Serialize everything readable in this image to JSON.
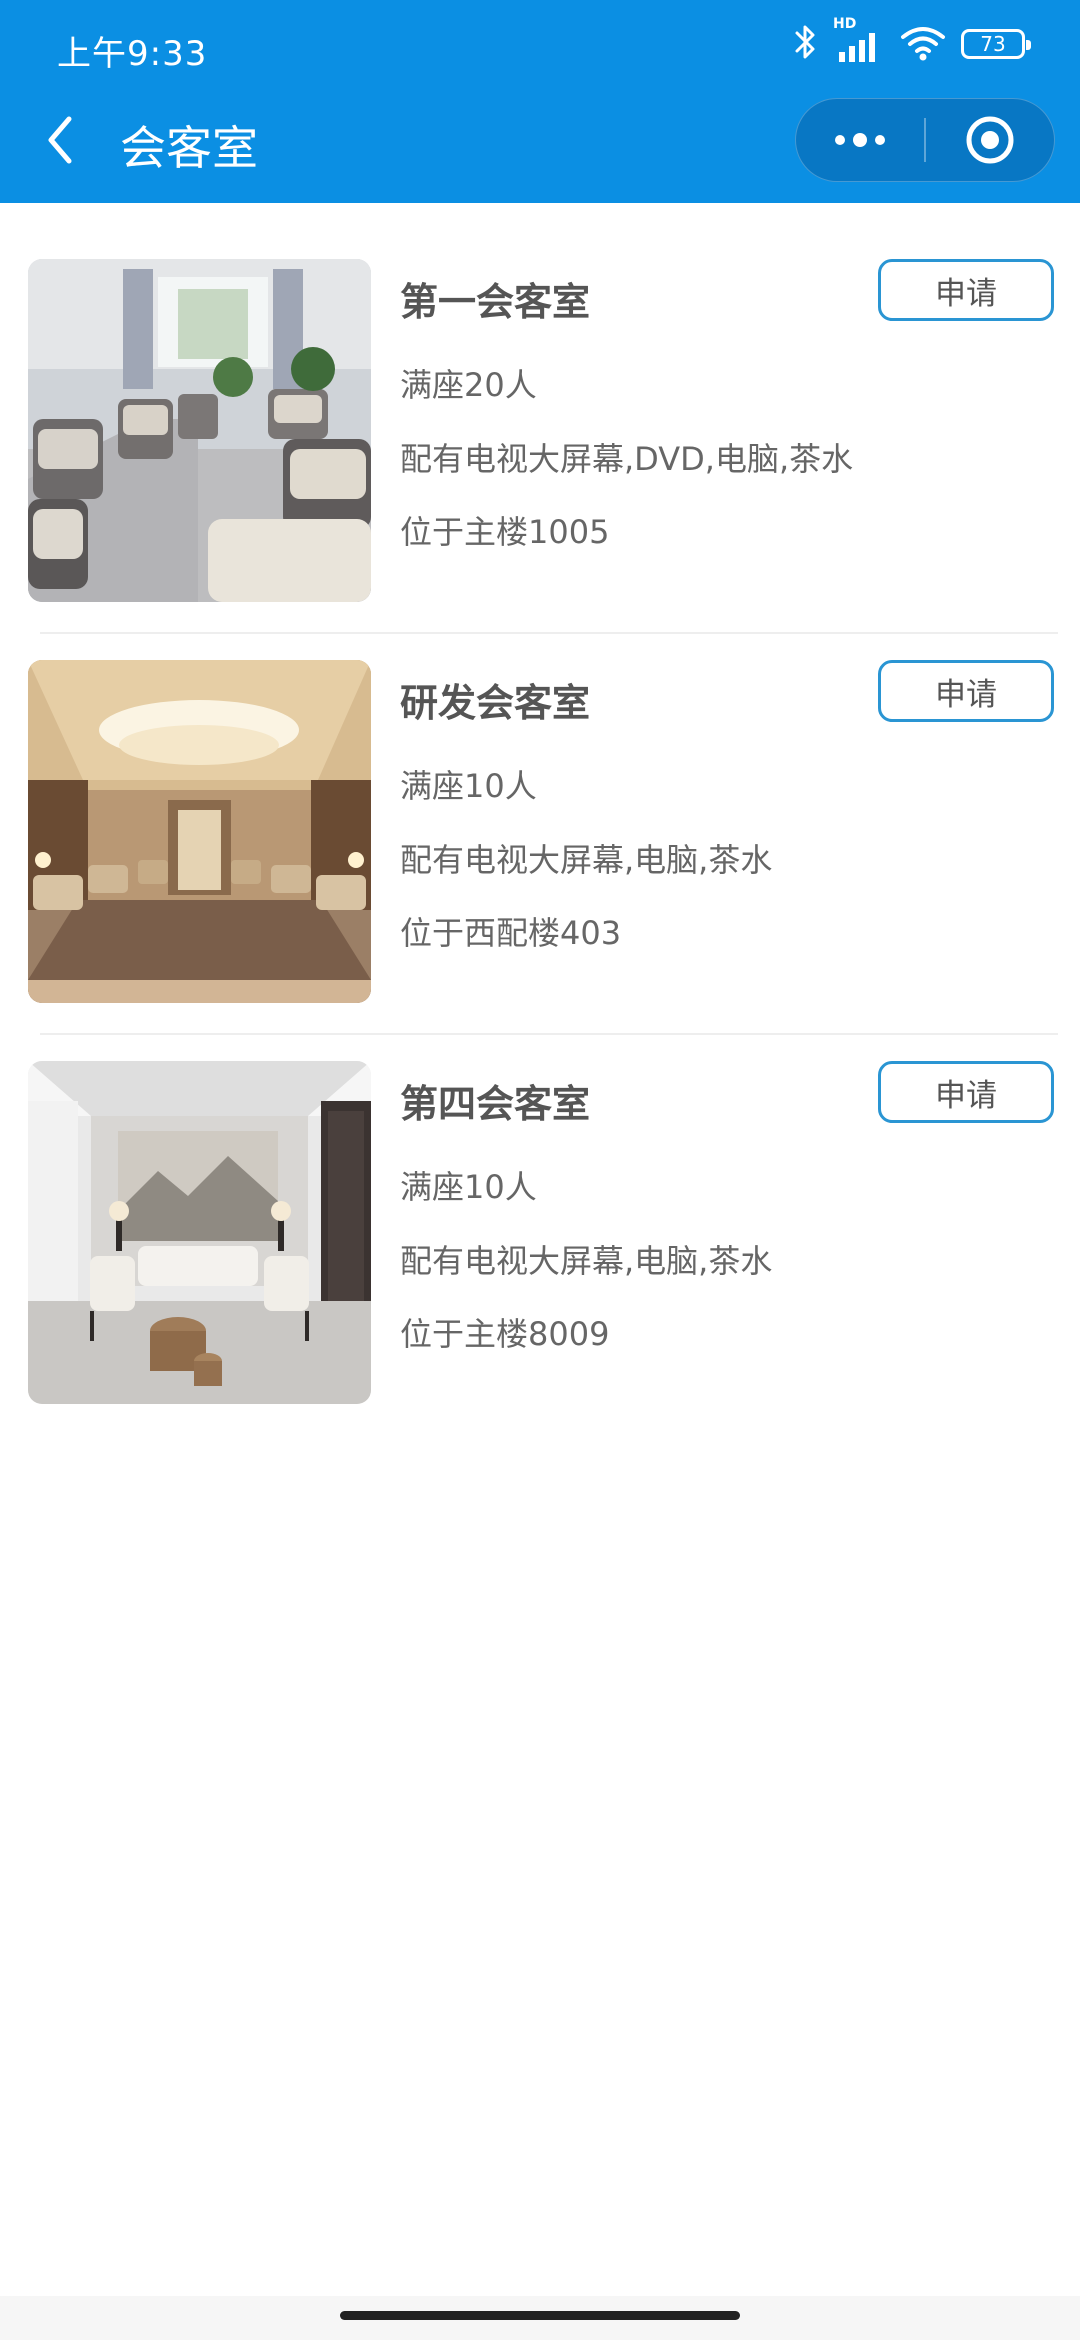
{
  "status_bar": {
    "time": "上午9:33",
    "network_label": "HD",
    "battery_level": "73",
    "icons": [
      "bluetooth-icon",
      "signal-icon",
      "wifi-icon",
      "battery-icon"
    ]
  },
  "nav": {
    "title": "会客室",
    "back_icon": "chevron-left-icon",
    "capsule_icons": [
      "more-dots-icon",
      "close-target-icon"
    ]
  },
  "colors": {
    "header_bg": "#0b8fe3",
    "capsule_bg": "#0877c4",
    "button_border": "#2a95d3",
    "name_text": "#555555",
    "info_text": "#666666"
  },
  "rooms": [
    {
      "name": "第一会客室",
      "capacity": "满座20人",
      "equipment": "配有电视大屏幕,DVD,电脑,茶水",
      "location": "位于主楼1005",
      "apply_label": "申请",
      "image": "meeting-room-photo-sofas"
    },
    {
      "name": "研发会客室",
      "capacity": "满座10人",
      "equipment": "配有电视大屏幕,电脑,茶水",
      "location": "位于西配楼403",
      "apply_label": "申请",
      "image": "meeting-room-photo-chandelier"
    },
    {
      "name": "第四会客室",
      "capacity": "满座10人",
      "equipment": "配有电视大屏幕,电脑,茶水",
      "location": "位于主楼8009",
      "apply_label": "申请",
      "image": "meeting-room-photo-modern"
    }
  ]
}
